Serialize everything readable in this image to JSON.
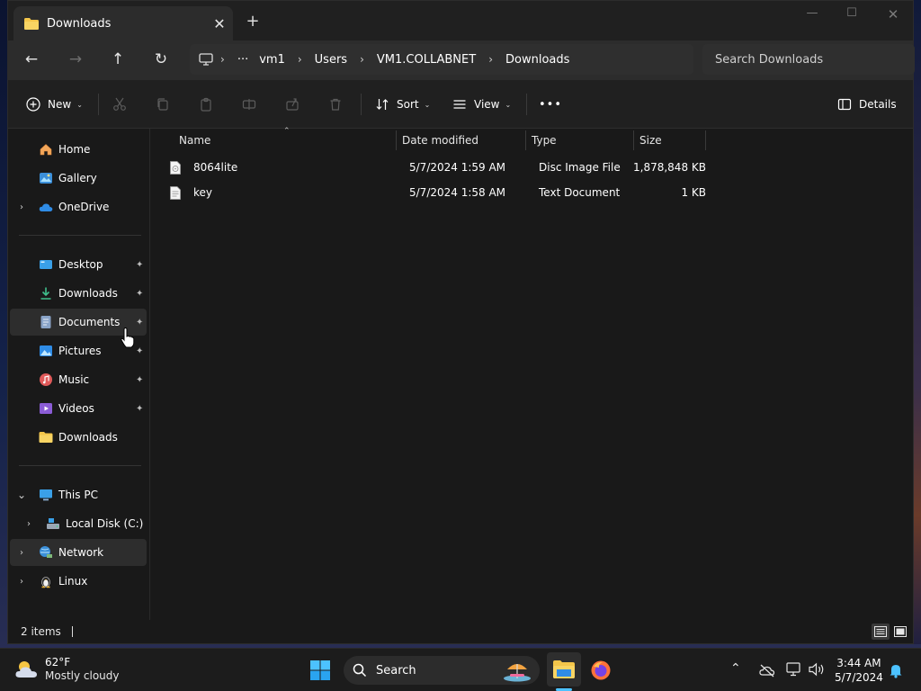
{
  "window": {
    "tab_title": "Downloads",
    "tab_close": "✕",
    "new_tab": "+",
    "minimize": "—",
    "maximize": "☐",
    "close": "✕"
  },
  "nav": {
    "back": "←",
    "forward": "→",
    "up": "↑",
    "refresh": "↻",
    "breadcrumb_more": "···",
    "breadcrumbs": [
      "vm1",
      "Users",
      "VM1.COLLABNET",
      "Downloads"
    ],
    "separator": "›",
    "search_placeholder": "Search Downloads"
  },
  "toolbar": {
    "new_label": "New",
    "sort_label": "Sort",
    "view_label": "View",
    "more_label": "•••",
    "details_label": "Details",
    "caret": "⌄"
  },
  "sidebar": {
    "quick": [
      {
        "label": "Home",
        "icon": "home-icon"
      },
      {
        "label": "Gallery",
        "icon": "gallery-icon"
      },
      {
        "label": "OneDrive",
        "icon": "cloud-icon"
      }
    ],
    "pinned": [
      {
        "label": "Desktop",
        "icon": "desktop-icon"
      },
      {
        "label": "Downloads",
        "icon": "download-icon"
      },
      {
        "label": "Documents",
        "icon": "documents-icon"
      },
      {
        "label": "Pictures",
        "icon": "pictures-icon"
      },
      {
        "label": "Music",
        "icon": "music-icon"
      },
      {
        "label": "Videos",
        "icon": "videos-icon"
      },
      {
        "label": "Downloads",
        "icon": "folder-icon"
      }
    ],
    "devices": [
      {
        "label": "This PC",
        "icon": "monitor-icon"
      },
      {
        "label": "Local Disk (C:)",
        "icon": "drive-icon"
      },
      {
        "label": "Network",
        "icon": "network-icon"
      },
      {
        "label": "Linux",
        "icon": "linux-icon"
      }
    ],
    "chevron_right": "›",
    "chevron_down": "⌄",
    "pin_glyph": "📌"
  },
  "filelist": {
    "columns": [
      "Name",
      "Date modified",
      "Type",
      "Size"
    ],
    "sort_arrow": "⌃",
    "rows": [
      {
        "name": "8064lite",
        "date": "5/7/2024 1:59 AM",
        "type": "Disc Image File",
        "size": "1,878,848 KB"
      },
      {
        "name": "key",
        "date": "5/7/2024 1:58 AM",
        "type": "Text Document",
        "size": "1 KB"
      }
    ]
  },
  "status": {
    "item_count": "2 items"
  },
  "taskbar": {
    "temperature": "62°F",
    "condition": "Mostly cloudy",
    "search_label": "Search",
    "time": "3:44 AM",
    "date": "5/7/2024",
    "tray_chevron": "⌃"
  },
  "colors": {
    "window_bg": "#191919",
    "accent": "#4cc2ff",
    "folder_yellow": "#f4c64a"
  }
}
